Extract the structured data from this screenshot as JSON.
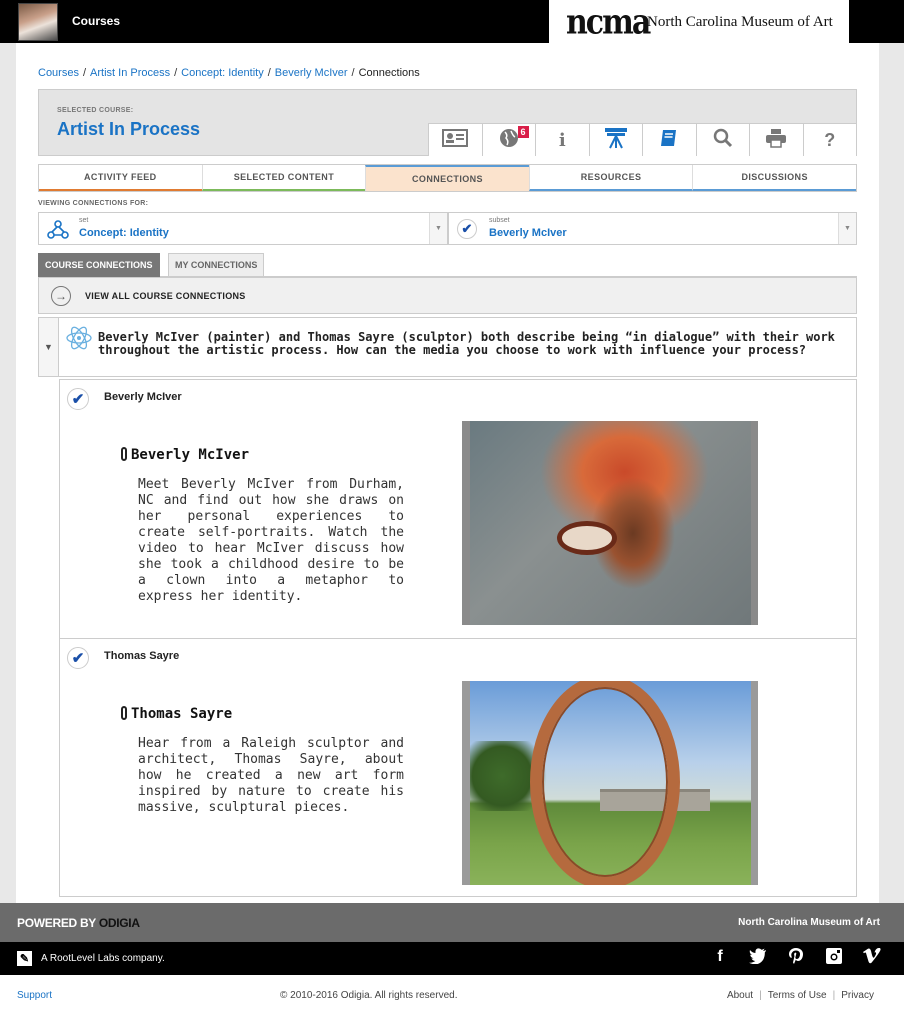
{
  "topbar": {
    "title": "Courses",
    "brand_logo": "ncma",
    "brand_name": "North Carolina Museum of Art"
  },
  "breadcrumb": {
    "items": [
      "Courses",
      "Artist In Process",
      "Concept: Identity",
      "Beverly McIver"
    ],
    "current": "Connections",
    "separator": "/"
  },
  "course": {
    "label": "SELECTED COURSE:",
    "name": "Artist In Process"
  },
  "toolbar": {
    "icons": [
      "profile-card-icon",
      "globe-icon",
      "info-icon",
      "easel-icon",
      "book-icon",
      "search-icon",
      "print-icon",
      "help-icon"
    ],
    "globe_badge": "6",
    "info_glyph": "i",
    "help_glyph": "?"
  },
  "tabs": [
    "ACTIVITY FEED",
    "SELECTED CONTENT",
    "CONNECTIONS",
    "RESOURCES",
    "DISCUSSIONS"
  ],
  "viewing": {
    "label": "VIEWING CONNECTIONS FOR:",
    "set_small": "set",
    "set_value": "Concept: Identity",
    "subset_small": "subset",
    "subset_value": "Beverly McIver"
  },
  "subtabs": {
    "active": "COURSE CONNECTIONS",
    "inactive": "MY CONNECTIONS"
  },
  "view_all": "VIEW ALL COURSE CONNECTIONS",
  "question": "Beverly McIver (painter) and Thomas Sayre (sculptor) both describe being “in dialogue” with their work throughout the artistic process. How can the media you choose to work with influence your process?",
  "items": [
    {
      "name": "Beverly McIver",
      "title": "Beverly McIver",
      "description": "Meet Beverly McIver from Durham, NC and find out how she draws on her personal experiences to create self-portraits. Watch the video to hear McIver discuss how she took a childhood desire to be a clown into a metaphor to express her identity."
    },
    {
      "name": "Thomas Sayre",
      "title": "Thomas Sayre",
      "description": "Hear from a Raleigh sculptor and architect, Thomas Sayre, about how he created a new art form inspired by nature to create his massive, sculptural pieces."
    }
  ],
  "footer": {
    "powered_by": "POWERED BY",
    "odigia": "ODIGIA",
    "museum": "North Carolina Museum of Art",
    "company": "A RootLevel Labs company.",
    "social": [
      "facebook-icon",
      "twitter-icon",
      "pinterest-icon",
      "instagram-icon",
      "vimeo-icon"
    ],
    "support": "Support",
    "copyright": "© 2010-2016 Odigia. All rights reserved.",
    "about": "About",
    "terms": "Terms of Use",
    "privacy": "Privacy"
  },
  "colors": {
    "accent": "#1a73c5",
    "badge": "#d91e48",
    "active_tab": "#fbe3cd"
  }
}
